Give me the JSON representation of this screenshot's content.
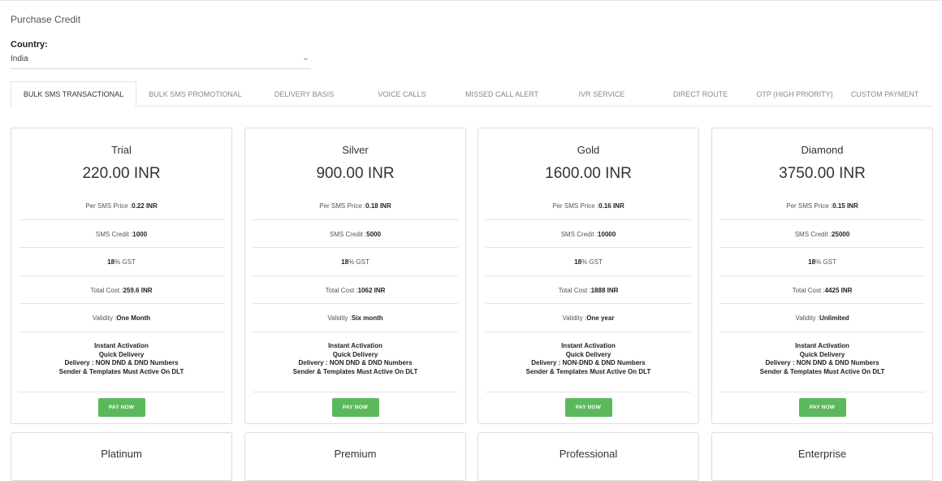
{
  "page_title": "Purchase Credit",
  "country": {
    "label": "Country:",
    "selected": "India",
    "chevron_icon": "chevron-down-icon"
  },
  "tabs": [
    {
      "label": "BULK SMS TRANSACTIONAL",
      "active": true
    },
    {
      "label": "BULK SMS PROMOTIONAL",
      "active": false
    },
    {
      "label": "DELIVERY BASIS",
      "active": false
    },
    {
      "label": "VOICE CALLS",
      "active": false
    },
    {
      "label": "MISSED CALL ALERT",
      "active": false
    },
    {
      "label": "IVR SERVICE",
      "active": false
    },
    {
      "label": "DIRECT ROUTE",
      "active": false
    },
    {
      "label": "OTP (HIGH PRIORITY)",
      "active": false
    },
    {
      "label": "CUSTOM PAYMENT",
      "active": false
    }
  ],
  "row_labels": {
    "per_sms": "Per SMS Price : ",
    "credit": "SMS Credit : ",
    "gst_suffix": " % GST",
    "total": "Total Cost : ",
    "validity": "Validity : "
  },
  "plans": [
    {
      "name": "Trial",
      "price": "220.00 INR",
      "per_sms": "0.22 INR",
      "credit": "1000",
      "gst": "18",
      "total": "259.6 INR",
      "validity": "One Month",
      "features": [
        "Instant Activation",
        "Quick Delivery",
        "Delivery : NON DND & DND Numbers",
        "Sender & Templates Must Active On DLT"
      ],
      "pay_label": "PAY NOW"
    },
    {
      "name": "Silver",
      "price": "900.00 INR",
      "per_sms": "0.18 INR",
      "credit": "5000",
      "gst": "18",
      "total": "1062 INR",
      "validity": "Six month",
      "features": [
        "Instant Activation",
        "Quick Delivery",
        "Delivery : NON DND & DND Numbers",
        "Sender & Templates Must Active On DLT"
      ],
      "pay_label": "PAY NOW"
    },
    {
      "name": "Gold",
      "price": "1600.00 INR",
      "per_sms": "0.16 INR",
      "credit": "10000",
      "gst": "18",
      "total": "1888 INR",
      "validity": "One year",
      "features": [
        "Instant Activation",
        "Quick Delivery",
        "Delivery : NON-DND & DND Numbers",
        "Sender & Templates Must Active On DLT"
      ],
      "pay_label": "PAY NOW"
    },
    {
      "name": "Diamond",
      "price": "3750.00 INR",
      "per_sms": "0.15 INR",
      "credit": "25000",
      "gst": "18",
      "total": "4425 INR",
      "validity": "Unlimited",
      "features": [
        "Instant Activation",
        "Quick Delivery",
        "Delivery : NON DND & DND Numbers",
        "Sender & Templates Must Active On DLT"
      ],
      "pay_label": "PAY NOW"
    }
  ],
  "more_plans": [
    "Platinum",
    "Premium",
    "Professional",
    "Enterprise"
  ]
}
